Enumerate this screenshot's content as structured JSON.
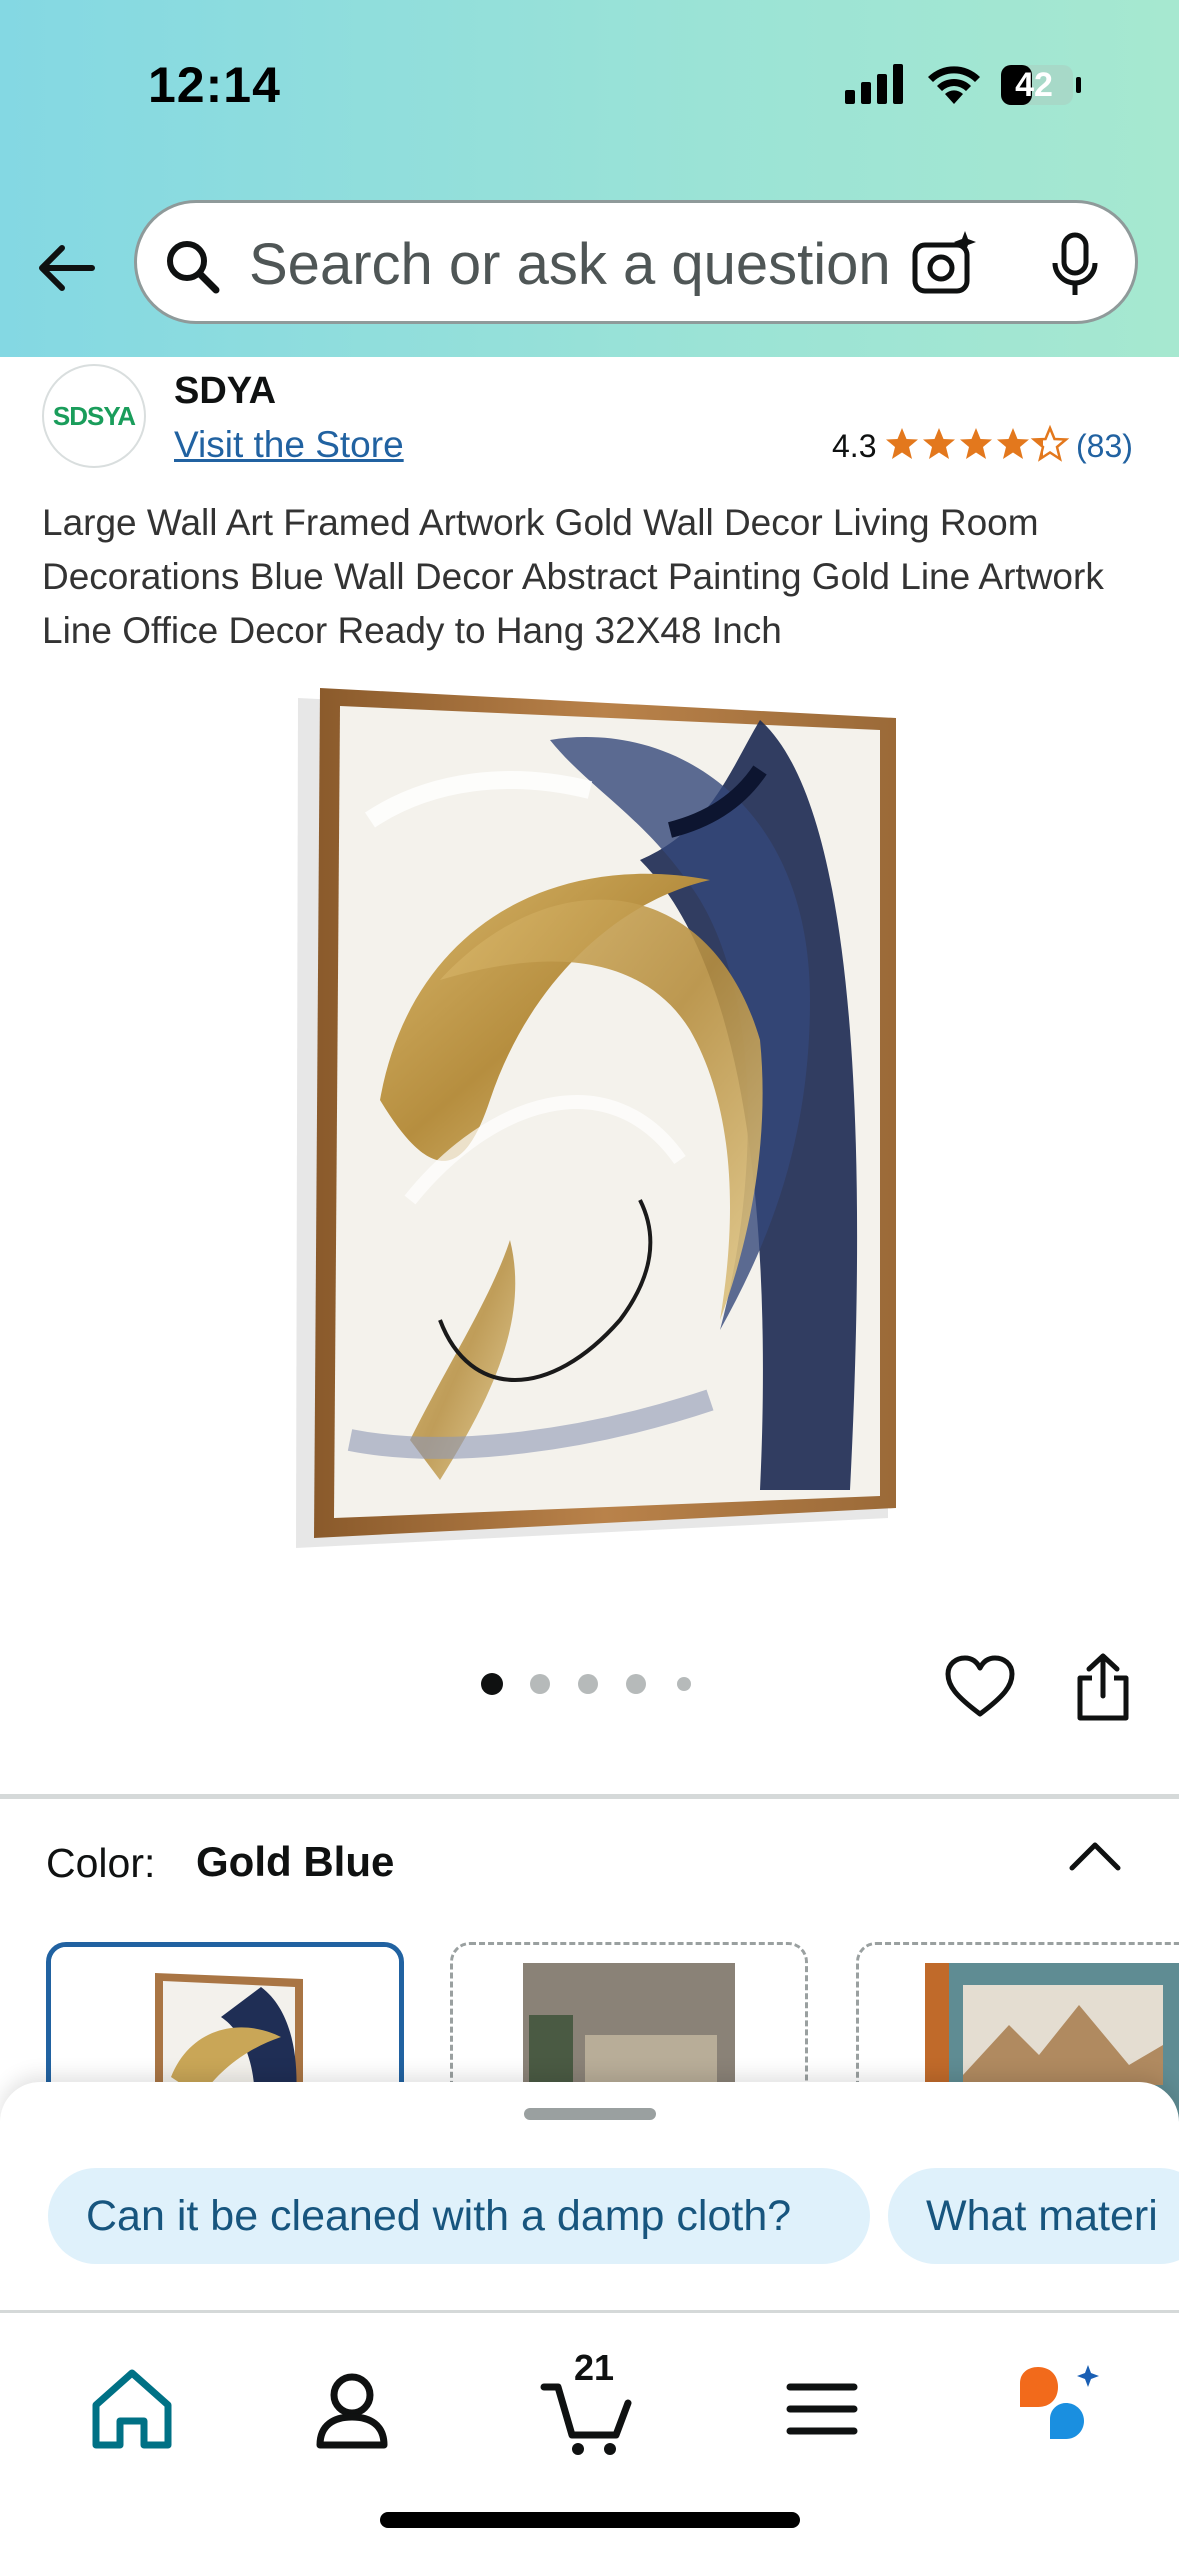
{
  "status_bar": {
    "time": "12:14",
    "battery": "42"
  },
  "search": {
    "placeholder": "Search or ask a question"
  },
  "store": {
    "logo_text": "SDSYA",
    "name": "SDYA",
    "link": "Visit the Store"
  },
  "rating": {
    "value": "4.3",
    "stars": 4.3,
    "count": "(83)"
  },
  "product": {
    "title": "Large Wall Art Framed Artwork Gold Wall Decor Living Room Decorations Blue Wall Decor Abstract Painting Gold Line Artwork Line Office Decor Ready to Hang 32X48 Inch"
  },
  "carousel": {
    "total": 5,
    "active_index": 0
  },
  "color": {
    "label": "Color:",
    "value": "Gold Blue"
  },
  "suggestions": [
    "Can it be cleaned with a damp cloth?",
    "What materi"
  ],
  "tabbar": {
    "cart_count": "21"
  },
  "colors": {
    "accent_link": "#2162a1",
    "star": "#e3781d",
    "home_active": "#007185"
  }
}
